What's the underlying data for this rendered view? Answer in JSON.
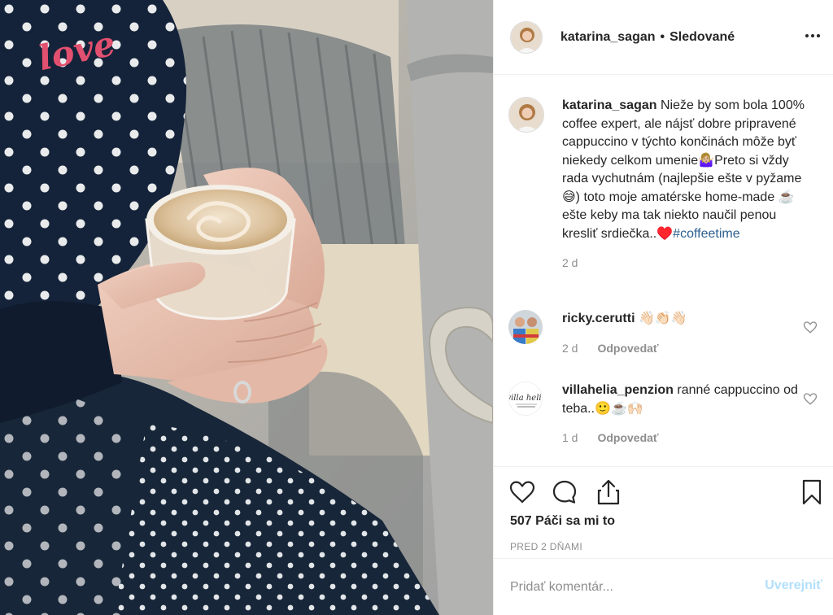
{
  "post": {
    "author": "katarina_sagan",
    "separator": "•",
    "follow_status": "Sledované",
    "more_icon": "more-horizontal-icon"
  },
  "caption": {
    "username": "katarina_sagan",
    "text": "Nieže by som bola 100% coffee expert, ale nájsť dobre pripravené cappuccino v týchto končinách môže byť niekedy celkom umenie🤷🏼‍♀️Preto si vždy rada vychutnám (najlepšie ešte v pyžame 😅) toto moje amatérske home-made ☕️ ešte keby ma tak niekto naučil penou kresliť srdiečka..♥️",
    "hashtag": "#coffeetime",
    "time": "2 d"
  },
  "comments": [
    {
      "username": "ricky.cerutti",
      "text": "👋🏻👏🏻👋🏻",
      "time": "2 d",
      "reply_label": "Odpovedať"
    },
    {
      "username": "villahelia_penzion",
      "text": "ranné cappuccino od teba..🙂☕️🙌🏻",
      "time": "1 d",
      "reply_label": "Odpovedať"
    }
  ],
  "actions": {
    "like_icon": "heart-icon",
    "comment_icon": "comment-icon",
    "share_icon": "share-icon",
    "save_icon": "bookmark-icon"
  },
  "likes": "507 Páči sa mi to",
  "post_date": "PRED 2 DŇAMI",
  "add_comment": {
    "placeholder": "Pridať komentár...",
    "post_label": "Uverejniť"
  },
  "colors": {
    "link": "#2d5f8f",
    "muted": "#8e8e8e",
    "post_disabled": "#b2dffc",
    "text": "#262626",
    "divider": "#efefef"
  }
}
